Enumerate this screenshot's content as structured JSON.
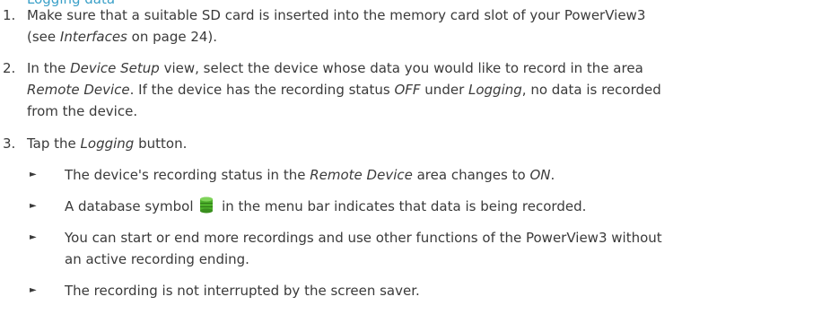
{
  "heading_fragment": "Logging data",
  "steps": [
    {
      "num": "1.",
      "line1_pre": "Make sure that a suitable SD card is inserted into the memory card slot of your PowerView3",
      "line2_pre": "(see ",
      "line2_em": "Interfaces",
      "line2_post": " on page 24)."
    },
    {
      "num": "2.",
      "line1_pre": "In the ",
      "line1_em": "Device Setup",
      "line1_post": " view, select the device whose data you would like to record in the area",
      "line2_em1": "Remote Device",
      "line2_mid1": ". If the device has the recording status ",
      "line2_em2": "OFF",
      "line2_mid2": " under ",
      "line2_em3": "Logging",
      "line2_post": ", no data is recorded",
      "line3": "from the device."
    },
    {
      "num": "3.",
      "pre": "Tap the ",
      "em": "Logging",
      "post": " button."
    }
  ],
  "bullets": [
    {
      "mark": "►",
      "pre": "The device's recording status in the ",
      "em1": "Remote Device",
      "mid": " area changes to ",
      "em2": "ON",
      "post": "."
    },
    {
      "mark": "►",
      "pre": "A database symbol",
      "icon": "database-icon",
      "post": "in the menu bar indicates that data is being recorded."
    },
    {
      "mark": "►",
      "line1": "You can start or end more recordings and use other functions of the PowerView3 without",
      "line2": "an active recording ending."
    },
    {
      "mark": "►",
      "text": "The recording is not interrupted by the screen saver."
    }
  ],
  "colors": {
    "text": "#3a3a3a",
    "heading": "#3aa0c8",
    "db_icon_green": "#4caf2a"
  }
}
